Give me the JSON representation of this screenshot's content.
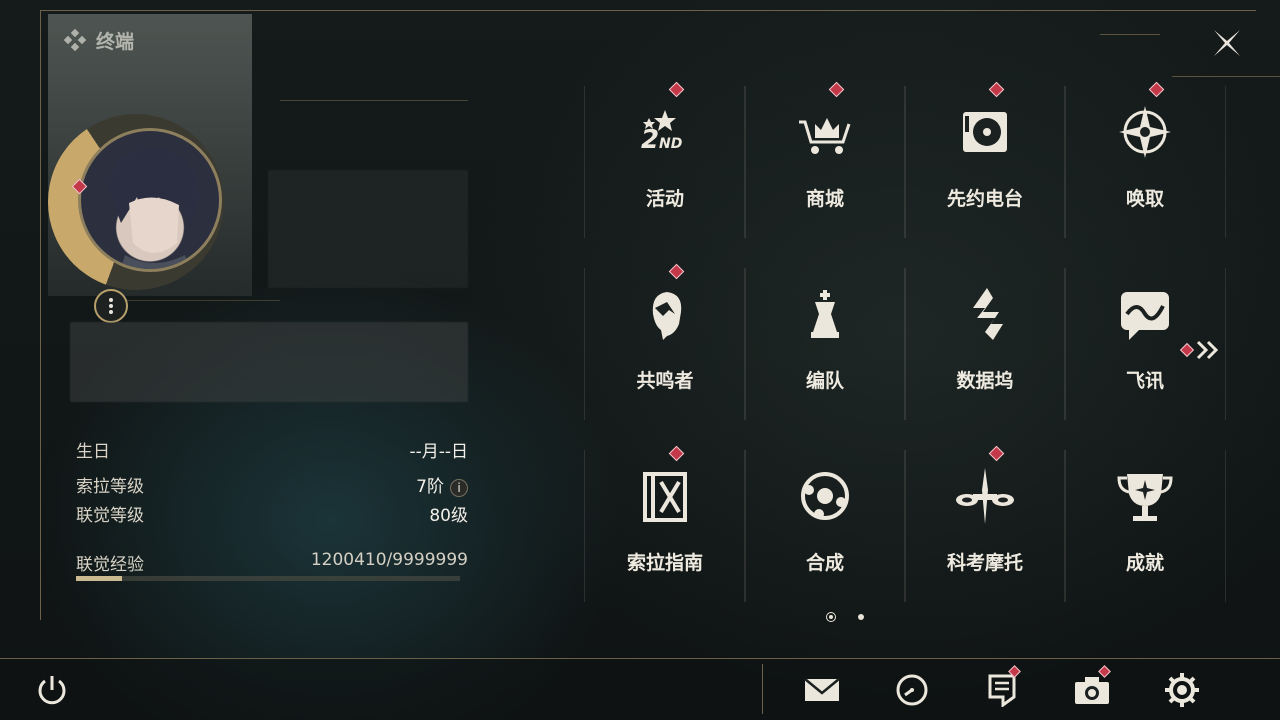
{
  "app": {
    "title": "终端"
  },
  "profile": {
    "fields": [
      {
        "label": "生日",
        "value": "--月--日"
      },
      {
        "label": "索拉等级",
        "value": "7阶"
      },
      {
        "label": "联觉等级",
        "value": "80级"
      },
      {
        "label": "联觉经验",
        "value": "1200410/9999999"
      }
    ],
    "exp_progress": 0.12,
    "info_glyph": "i"
  },
  "menu": {
    "items": [
      {
        "label": "活动",
        "icon": "event-2nd-anniversary-icon",
        "badge": true
      },
      {
        "label": "商城",
        "icon": "shop-cart-crown-icon",
        "badge": true
      },
      {
        "label": "先约电台",
        "icon": "radio-turntable-icon",
        "badge": true
      },
      {
        "label": "唤取",
        "icon": "compass-star-icon",
        "badge": true
      },
      {
        "label": "共鸣者",
        "icon": "resonator-portrait-icon",
        "badge": true
      },
      {
        "label": "编队",
        "icon": "chess-team-icon",
        "badge": false
      },
      {
        "label": "数据坞",
        "icon": "data-dock-icon",
        "badge": false
      },
      {
        "label": "飞讯",
        "icon": "chat-message-icon",
        "badge": false
      },
      {
        "label": "索拉指南",
        "icon": "guide-book-icon",
        "badge": true
      },
      {
        "label": "合成",
        "icon": "synthesis-orb-icon",
        "badge": false
      },
      {
        "label": "科考摩托",
        "icon": "motorbike-icon",
        "badge": true
      },
      {
        "label": "成就",
        "icon": "trophy-icon",
        "badge": false
      }
    ],
    "next_page_badge": true,
    "pages": 2,
    "current_page": 1
  },
  "bottom_bar": {
    "buttons": [
      {
        "name": "power-icon",
        "badge": false
      },
      {
        "name": "mail-icon",
        "badge": false
      },
      {
        "name": "clock-icon",
        "badge": false
      },
      {
        "name": "notice-icon",
        "badge": true
      },
      {
        "name": "camera-icon",
        "badge": true
      },
      {
        "name": "settings-gear-icon",
        "badge": false
      }
    ]
  },
  "colors": {
    "accent_gold": "#c9a96b",
    "badge_red": "#c4394a",
    "text": "#eeeae0"
  }
}
